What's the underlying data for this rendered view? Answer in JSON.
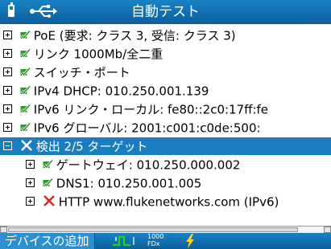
{
  "header": {
    "title": "自動テスト",
    "battery_icon": "battery-icon",
    "usb_icon": "usb-icon"
  },
  "tree": {
    "items": [
      {
        "label": "PoE (要求: クラス 3, 受信: クラス 3)",
        "status": "pass"
      },
      {
        "label": "リンク 1000Mb/全二重",
        "status": "pass"
      },
      {
        "label": "スイッチ・ポート",
        "status": "pass"
      },
      {
        "label": "IPv4 DHCP: 010.250.001.139",
        "status": "pass"
      },
      {
        "label": "IPv6 リンク・ローカル: fe80::2c0:17ff:fe",
        "status": "pass"
      },
      {
        "label": "IPv6 グローバル: 2001:c001:c0de:500:",
        "status": "pass"
      },
      {
        "label": "検出 2/5 ターゲット",
        "status": "fail",
        "expanded": true,
        "selected": true
      },
      {
        "label": "ゲートウェイ: 010.250.000.002",
        "status": "pass"
      },
      {
        "label": "DNS1: 010.250.001.005",
        "status": "pass"
      },
      {
        "label": "HTTP www.flukenetworks.com (IPv6)",
        "status": "fail"
      }
    ]
  },
  "footer": {
    "add_device": "デバイスの追加",
    "link_speed": "1000",
    "link_duplex": "FDx"
  },
  "colors": {
    "bar_blue": "#1a7dc0",
    "pass_green": "#2e9a2e",
    "fail_red": "#e02020",
    "bolt_yellow": "#ffd21e"
  }
}
